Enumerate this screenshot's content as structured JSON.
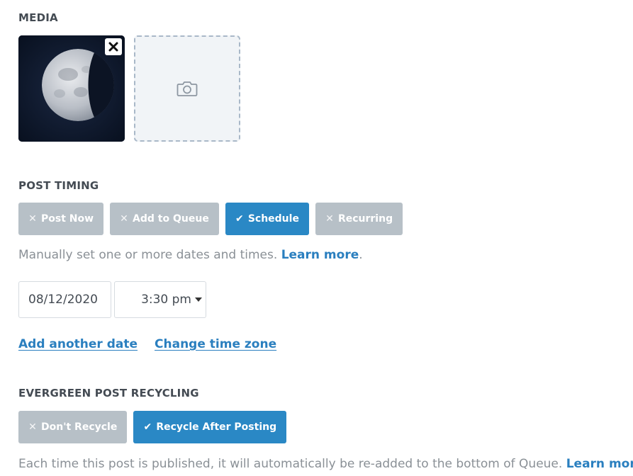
{
  "media": {
    "heading": "MEDIA",
    "remove_icon": "close-icon",
    "add_icon": "camera-icon"
  },
  "post_timing": {
    "heading": "POST TIMING",
    "options": [
      {
        "label": "Post Now",
        "selected": false
      },
      {
        "label": "Add to Queue",
        "selected": false
      },
      {
        "label": "Schedule",
        "selected": true
      },
      {
        "label": "Recurring",
        "selected": false
      }
    ],
    "help_text": "Manually set one or more dates and times.",
    "help_link": "Learn more",
    "help_suffix": ".",
    "date_value": "08/12/2020",
    "time_value": "3:30 pm",
    "add_date_link": "Add another date",
    "change_timezone_link": "Change time zone"
  },
  "recycling": {
    "heading": "EVERGREEN POST RECYCLING",
    "options": [
      {
        "label": "Don't Recycle",
        "selected": false
      },
      {
        "label": "Recycle After Posting",
        "selected": true
      }
    ],
    "help_text": "Each time this post is published, it will automatically be re-added to the bottom of Queue.",
    "help_link": "Learn more",
    "help_suffix": "."
  },
  "colors": {
    "accent": "#2a88c5",
    "inactive": "#b7c0c7",
    "link": "#2a7fbf",
    "text": "#444b53",
    "muted": "#8a9096"
  }
}
